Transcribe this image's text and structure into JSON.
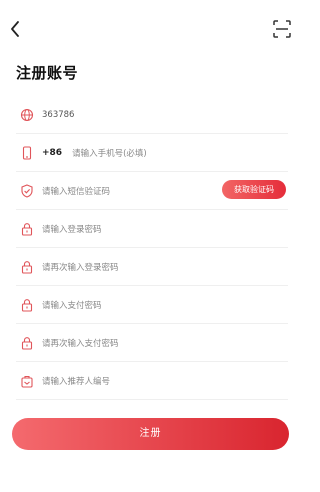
{
  "header": {
    "back_icon": "chevron-left-icon",
    "scan_icon": "scan-icon"
  },
  "page_title": "注册账号",
  "form": {
    "invite_code_value": "363786",
    "phone_prefix": "+86",
    "phone_placeholder": "请输入手机号(必填)",
    "sms_code_placeholder": "请输入短信验证码",
    "get_code_label": "获取验证码",
    "login_password_placeholder": "请输入登录密码",
    "login_password_confirm_placeholder": "请再次输入登录密码",
    "pay_password_placeholder": "请输入支付密码",
    "pay_password_confirm_placeholder": "请再次输入支付密码",
    "referrer_placeholder": "请输入推荐人编号"
  },
  "submit_label": "注册",
  "colors": {
    "accent": "#e52d3a",
    "icon": "#e0555a"
  }
}
